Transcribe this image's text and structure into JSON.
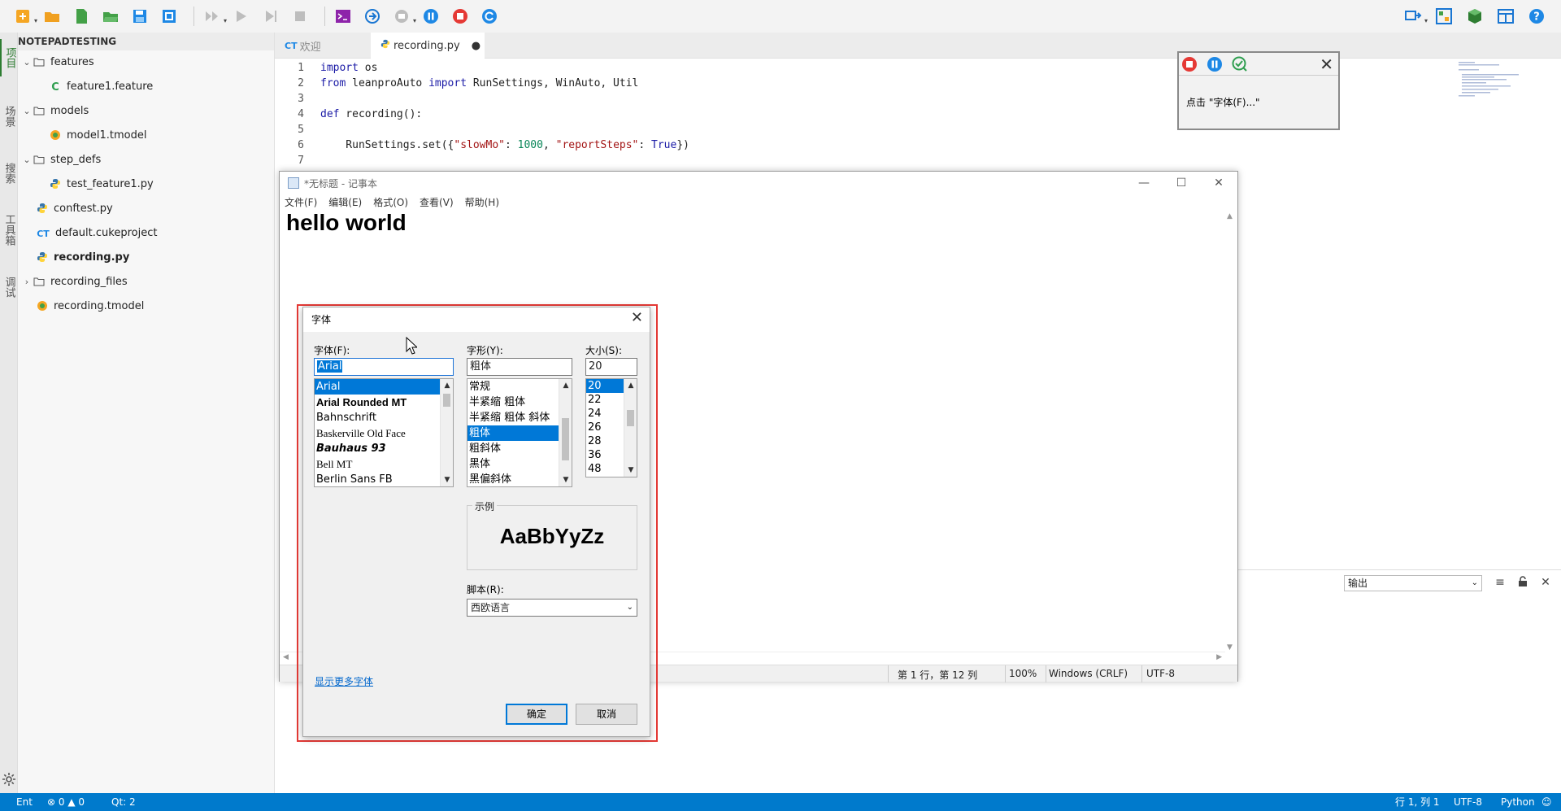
{
  "explorer": {
    "project_title": "NOTEPADTESTING",
    "items": [
      {
        "label": "features",
        "type": "folder",
        "expanded": true
      },
      {
        "label": "feature1.feature",
        "type": "feature"
      },
      {
        "label": "models",
        "type": "folder",
        "expanded": true
      },
      {
        "label": "model1.tmodel",
        "type": "tmodel"
      },
      {
        "label": "step_defs",
        "type": "folder",
        "expanded": true
      },
      {
        "label": "test_feature1.py",
        "type": "python"
      },
      {
        "label": "conftest.py",
        "type": "python"
      },
      {
        "label": "default.cukeproject",
        "type": "cukeproject"
      },
      {
        "label": "recording.py",
        "type": "python"
      },
      {
        "label": "recording_files",
        "type": "folder",
        "expanded": false
      },
      {
        "label": "recording.tmodel",
        "type": "tmodel"
      }
    ]
  },
  "activity_bar": {
    "tabs": [
      "项目",
      "场景",
      "搜索",
      "工具箱",
      "调试"
    ]
  },
  "editor": {
    "tabs": [
      {
        "icon": "CT",
        "label": "欢迎"
      },
      {
        "label": "recording.py",
        "modified_mark": "●"
      }
    ],
    "lines": [
      "1",
      "2",
      "3",
      "4",
      "5",
      "6",
      "7"
    ],
    "code": {
      "l1": [
        "import",
        " os"
      ],
      "l2": [
        "from",
        " leanproAuto ",
        "import",
        " RunSettings, WinAuto, Util"
      ],
      "l4": [
        "def",
        " recording():"
      ],
      "l6": [
        "    RunSettings.set({",
        "\"slowMo\"",
        ": ",
        "1000",
        ", ",
        "\"reportSteps\"",
        ": ",
        "True",
        "})"
      ]
    }
  },
  "output": {
    "selected": "输出"
  },
  "statusbar": {
    "left_label": "Ent",
    "errors": "0",
    "warnings": "0",
    "qt": "Qt: 2",
    "position": "行 1, 列 1",
    "encoding": "UTF-8",
    "language": "Python"
  },
  "notepad": {
    "title": "*无标题 - 记事本",
    "menu": [
      "文件(F)",
      "编辑(E)",
      "格式(O)",
      "查看(V)",
      "帮助(H)"
    ],
    "content": "hello world",
    "status": {
      "position": "第 1 行，第 12 列",
      "zoom": "100%",
      "line_ending": "Windows (CRLF)",
      "encoding": "UTF-8"
    }
  },
  "font_dialog": {
    "title": "字体",
    "font_label": "字体(F):",
    "font_value": "Arial",
    "font_list": [
      "Arial",
      "Arial Rounded MT",
      "Bahnschrift",
      "Baskerville Old Face",
      "Bauhaus 93",
      "Bell MT",
      "Berlin Sans FB"
    ],
    "style_label": "字形(Y):",
    "style_value": "粗体",
    "style_list": [
      "常规",
      "半紧缩 粗体",
      "半紧缩 粗体 斜体",
      "粗体",
      "粗斜体",
      "黑体",
      "黑偏斜体"
    ],
    "size_label": "大小(S):",
    "size_value": "20",
    "size_list": [
      "20",
      "22",
      "24",
      "26",
      "28",
      "36",
      "48"
    ],
    "sample_label": "示例",
    "sample_text": "AaBbYyZz",
    "script_label": "脚本(R):",
    "script_value": "西欧语言",
    "more_fonts": "显示更多字体",
    "ok": "确定",
    "cancel": "取消"
  },
  "recorder": {
    "step_text": "点击 \"字体(F)...\""
  },
  "colors": {
    "statusbar": "#007acc",
    "selection": "#0078d7",
    "highlight_border": "#e53935"
  }
}
